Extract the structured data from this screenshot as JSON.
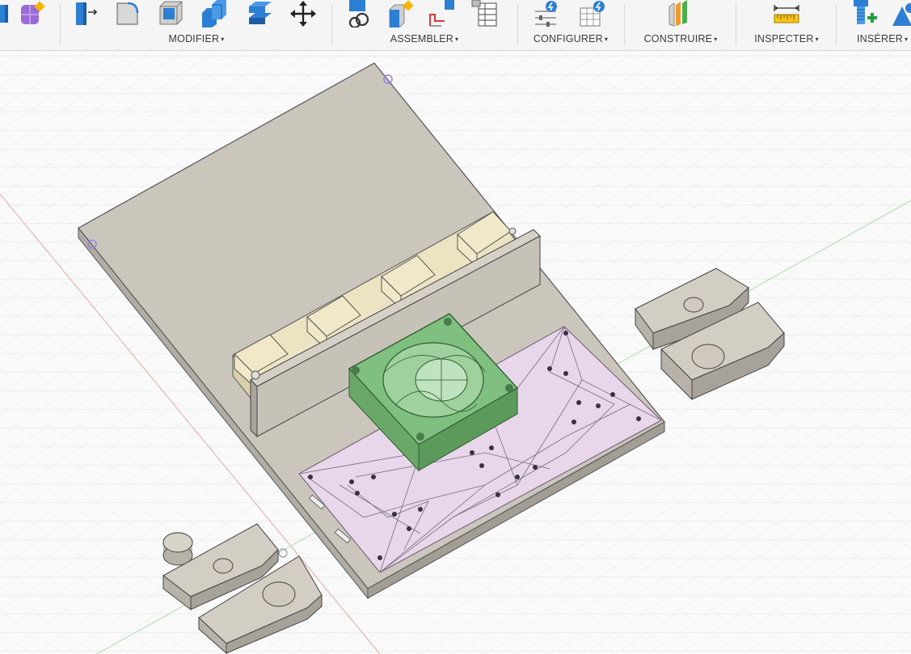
{
  "toolbar": {
    "groups": [
      {
        "label": "MODIFIER"
      },
      {
        "label": "ASSEMBLER"
      },
      {
        "label": "CONFIGURER"
      },
      {
        "label": "CONSTRUIRE"
      },
      {
        "label": "INSPECTER"
      },
      {
        "label": "INSÉRER"
      }
    ],
    "caret": "▾"
  },
  "icons": {
    "create": [
      "form-icon"
    ],
    "modify": [
      "press-pull-icon",
      "fillet-icon",
      "shell-icon",
      "combine-icon",
      "replace-face-icon",
      "move-copy-icon"
    ],
    "assemble": [
      "new-component-icon",
      "joint-icon",
      "as-built-joint-icon",
      "table-icon"
    ],
    "configure": [
      "configure-parameter-icon",
      "configure-table-icon"
    ],
    "construct": [
      "midplane-icon"
    ],
    "inspect": [
      "measure-icon"
    ],
    "insert": [
      "insert-mcmaster-icon",
      "insert-decal-icon"
    ]
  },
  "colors": {
    "toolbar_bg": "#f5f5f5",
    "grid": "#e2e2e2",
    "body_gray": "#cbc6bc",
    "fan_green": "#7fbf7f",
    "mesh_pink": "#e8d7ea",
    "switch_cream": "#f0e8c8",
    "icon_blue": "#2d7fd3"
  }
}
